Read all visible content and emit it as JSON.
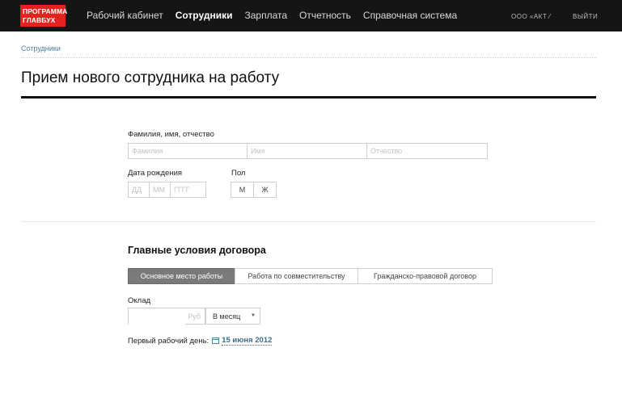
{
  "header": {
    "logo": [
      "ПРОГРАММА",
      "ГЛАВБУХ"
    ],
    "nav": [
      {
        "label": "Рабочий кабинет",
        "active": false
      },
      {
        "label": "Сотрудники",
        "active": true
      },
      {
        "label": "Зарплата",
        "active": false
      },
      {
        "label": "Отчетность",
        "active": false
      },
      {
        "label": "Справочная система",
        "active": false
      }
    ],
    "org": "ООО «АКТ ⁄",
    "exit": "ВЫЙТИ"
  },
  "breadcrumb": "Сотрудники",
  "page_title": "Прием нового сотрудника на работу",
  "form": {
    "fio_label": "Фамилия, имя, отчество",
    "surname_placeholder": "Фамилия",
    "name_placeholder": "Имя",
    "patronymic_placeholder": "Отчество",
    "birth_label": "Дата рождения",
    "day_placeholder": "ДД",
    "month_placeholder": "ММ",
    "year_placeholder": "ГГГГ",
    "gender_label": "Пол",
    "gender_male": "М",
    "gender_female": "Ж"
  },
  "contract": {
    "title": "Главные условия договора",
    "types": [
      {
        "label": "Основное место работы",
        "selected": true
      },
      {
        "label": "Работа по совместительству",
        "selected": false
      },
      {
        "label": "Гражданско-правовой договор",
        "selected": false
      }
    ],
    "salary_label": "Оклад",
    "salary_value": "",
    "salary_unit": "Руб",
    "period": "В месяц",
    "start_label": "Первый рабочий день:",
    "start_date": "15 июня 2012"
  },
  "colors": {
    "topbar": "#151515",
    "logo": "#e4231e",
    "link": "#4f7f9a",
    "selected_segment": "#7a7a7a"
  }
}
